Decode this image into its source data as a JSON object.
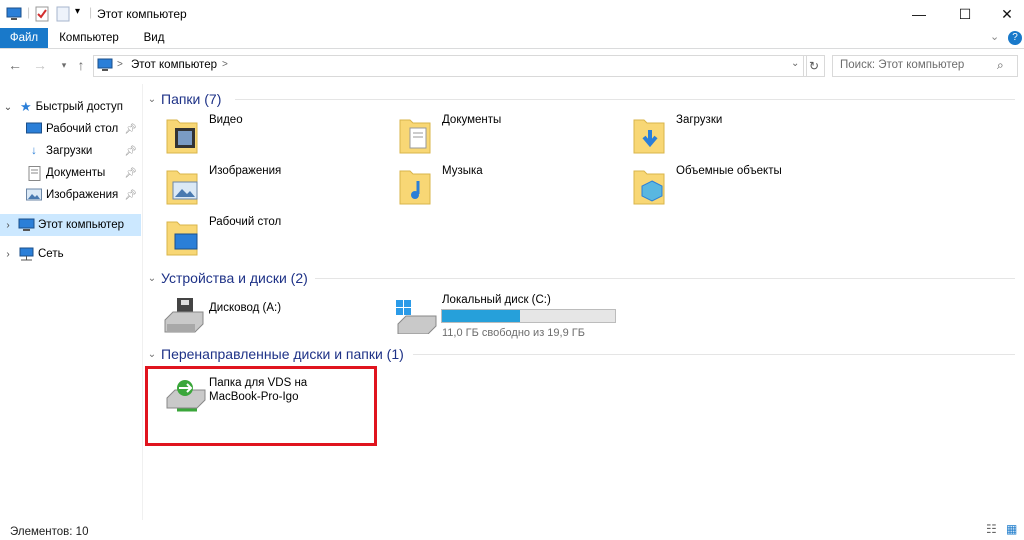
{
  "window": {
    "title": "Этот компьютер",
    "minimize": "—",
    "maximize": "☐",
    "close": "✕"
  },
  "ribbon": {
    "tabs": [
      "Файл",
      "Компьютер",
      "Вид"
    ]
  },
  "address": {
    "breadcrumb_sep": ">",
    "location": "Этот компьютер",
    "location_chevron": ">",
    "search_placeholder": "Поиск: Этот компьютер"
  },
  "nav": {
    "quick_access": "Быстрый доступ",
    "quick_items": [
      {
        "label": "Рабочий стол",
        "icon": "desktop-icon"
      },
      {
        "label": "Загрузки",
        "icon": "download-icon"
      },
      {
        "label": "Документы",
        "icon": "documents-icon"
      },
      {
        "label": "Изображения",
        "icon": "pictures-icon"
      }
    ],
    "this_pc": "Этот компьютер",
    "network": "Сеть"
  },
  "groups": {
    "folders": {
      "title": "Папки (7)",
      "items": [
        "Видео",
        "Документы",
        "Загрузки",
        "Изображения",
        "Музыка",
        "Объемные объекты",
        "Рабочий стол"
      ]
    },
    "drives": {
      "title": "Устройства и диски (2)",
      "floppy": "Дисковод (A:)",
      "local": "Локальный диск (C:)",
      "local_free": "11,0 ГБ свободно из 19,9 ГБ",
      "local_used_fraction": 0.45
    },
    "redirected": {
      "title": "Перенаправленные диски и папки (1)",
      "item_line1": "Папка для VDS на",
      "item_line2": "MacBook-Pro-Igo"
    }
  },
  "status": {
    "count": "Элементов: 10"
  },
  "colors": {
    "accent": "#1979ca",
    "group_header": "#1e3287",
    "selection": "#cce8ff",
    "bar_fill": "#26a0da",
    "highlight": "#e0141e"
  }
}
